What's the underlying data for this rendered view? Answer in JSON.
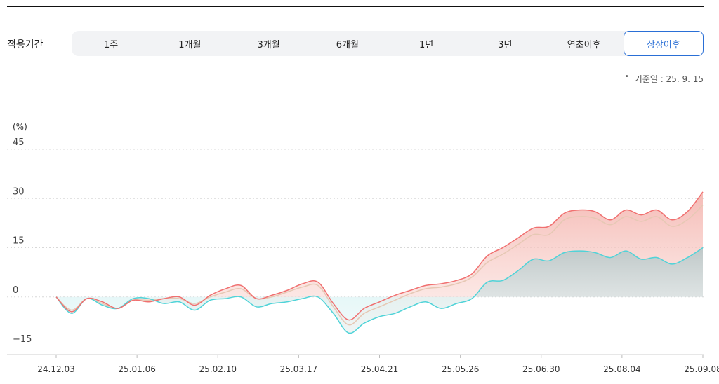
{
  "period_selector": {
    "label": "적용기간",
    "tabs": [
      "1주",
      "1개월",
      "3개월",
      "6개월",
      "1년",
      "3년",
      "연초이후",
      "상장이후"
    ],
    "active_index": 7
  },
  "base_date": "기준일 : 25. 9. 15",
  "chart_data": {
    "type": "area",
    "y_unit_label": "(%)",
    "ylim": [
      -18,
      45
    ],
    "y_ticks": [
      45,
      30,
      15,
      0,
      -15
    ],
    "y_tick_labels": [
      "45",
      "30",
      "15",
      "0",
      "−15"
    ],
    "x_tick_labels": [
      "24.12.03",
      "25.01.06",
      "25.02.10",
      "25.03.17",
      "25.04.21",
      "25.05.26",
      "25.06.30",
      "25.08.04",
      "25.09.08"
    ],
    "grid": true,
    "colors": {
      "red_series": "#f07070",
      "teal_series": "#4fd3d8",
      "middle_line": "#e6c8b4",
      "red_fill": "#f4b4ae",
      "teal_fill": "#cdeff0",
      "neutral_fill": "#b8c2c2"
    },
    "series": [
      {
        "values": [
          0,
          -4.5,
          -0.5,
          -1.5,
          -3.5,
          -1,
          -1.5,
          -0.5,
          0,
          -2.5,
          0.5,
          2.5,
          3.5,
          -0.5,
          0.5,
          2,
          4,
          4.5,
          -2,
          -7,
          -3.5,
          -1.5,
          0.5,
          2,
          3.5,
          4,
          5,
          7,
          12.5,
          15,
          18,
          21,
          21.5,
          25.5,
          26.5,
          26,
          23.5,
          26.5,
          25,
          26.5,
          23.5,
          26,
          32
        ]
      },
      {
        "values": [
          0,
          -4,
          -0.5,
          -2,
          -3.5,
          -1,
          -1,
          -0.5,
          -0.5,
          -2,
          0,
          1.5,
          2.5,
          -0.5,
          0,
          1.5,
          3,
          3.5,
          -3,
          -8.5,
          -5,
          -3,
          -1,
          1,
          2.5,
          3,
          4,
          6,
          10.5,
          13,
          16,
          19,
          19,
          23.5,
          24.5,
          24,
          22,
          24.5,
          23,
          24.5,
          21.5,
          23.5,
          28
        ]
      },
      {
        "values": [
          0,
          -5,
          -0.5,
          -2.5,
          -3.5,
          -0.5,
          -0.5,
          -2,
          -1.5,
          -4,
          -1,
          -0.5,
          0,
          -3,
          -2,
          -1.5,
          -0.5,
          0,
          -5,
          -11,
          -8,
          -6,
          -5,
          -3,
          -1.5,
          -3.5,
          -2,
          -0.5,
          4.5,
          5,
          8,
          11.5,
          11,
          13.5,
          14,
          13.5,
          12,
          14,
          11.5,
          12,
          10,
          12,
          15
        ]
      }
    ]
  }
}
